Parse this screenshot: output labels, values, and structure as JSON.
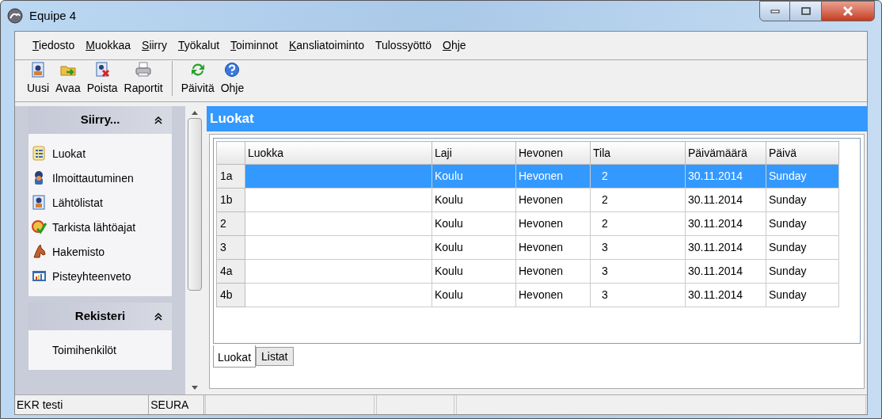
{
  "window": {
    "title": "Equipe 4"
  },
  "menu": [
    {
      "label": "Tiedosto",
      "mnemonic": true
    },
    {
      "label": "Muokkaa",
      "mnemonic": true
    },
    {
      "label": "Siirry",
      "mnemonic": true
    },
    {
      "label": "Työkalut",
      "mnemonic": true
    },
    {
      "label": "Toiminnot",
      "mnemonic": true
    },
    {
      "label": "Kansliatoiminto",
      "mnemonic": true
    },
    {
      "label": "Tulossyöttö",
      "mnemonic": false
    },
    {
      "label": "Ohje",
      "mnemonic": true
    }
  ],
  "toolbar": {
    "groups": [
      {
        "buttons": [
          {
            "label": "Uusi",
            "kind": "new"
          },
          {
            "label": "Avaa",
            "kind": "open"
          },
          {
            "label": "Poista",
            "kind": "delete"
          },
          {
            "label": "Raportit",
            "kind": "print"
          }
        ]
      },
      {
        "buttons": [
          {
            "label": "Päivitä",
            "kind": "refresh"
          },
          {
            "label": "Ohje",
            "kind": "help"
          }
        ]
      }
    ]
  },
  "sidebar": {
    "groups": [
      {
        "title": "Siirry...",
        "expanded": true,
        "items": [
          {
            "label": "Luokat",
            "kind": "list"
          },
          {
            "label": "Ilmoittautuminen",
            "kind": "rider"
          },
          {
            "label": "Lähtölistat",
            "kind": "doc"
          },
          {
            "label": "Tarkista lähtöajat",
            "kind": "check"
          },
          {
            "label": "Hakemisto",
            "kind": "horse"
          },
          {
            "label": "Pisteyhteenveto",
            "kind": "chart"
          }
        ]
      },
      {
        "title": "Rekisteri",
        "expanded": true,
        "items": [
          {
            "label": "Toimihenkilöt",
            "kind": "none"
          }
        ]
      }
    ]
  },
  "panel": {
    "title": "Luokat"
  },
  "table": {
    "columns": [
      "Luokka",
      "Laji",
      "Hevonen",
      "Tila",
      "Päivämäärä",
      "Päivä"
    ],
    "rows": [
      {
        "header": "1a",
        "selected": true,
        "cells": [
          "",
          "Koulu",
          "Hevonen",
          "2",
          "30.11.2014",
          "Sunday"
        ]
      },
      {
        "header": "1b",
        "selected": false,
        "cells": [
          "",
          "Koulu",
          "Hevonen",
          "2",
          "30.11.2014",
          "Sunday"
        ]
      },
      {
        "header": "2",
        "selected": false,
        "cells": [
          "",
          "Koulu",
          "Hevonen",
          "2",
          "30.11.2014",
          "Sunday"
        ]
      },
      {
        "header": "3",
        "selected": false,
        "cells": [
          "",
          "Koulu",
          "Hevonen",
          "3",
          "30.11.2014",
          "Sunday"
        ]
      },
      {
        "header": "4a",
        "selected": false,
        "cells": [
          "",
          "Koulu",
          "Hevonen",
          "3",
          "30.11.2014",
          "Sunday"
        ]
      },
      {
        "header": "4b",
        "selected": false,
        "cells": [
          "",
          "Koulu",
          "Hevonen",
          "3",
          "30.11.2014",
          "Sunday"
        ]
      }
    ]
  },
  "tabs": [
    {
      "label": "Luokat",
      "selected": true
    },
    {
      "label": "Listat",
      "selected": false
    }
  ],
  "status_bar": [
    "EKR testi",
    "SEURA"
  ]
}
